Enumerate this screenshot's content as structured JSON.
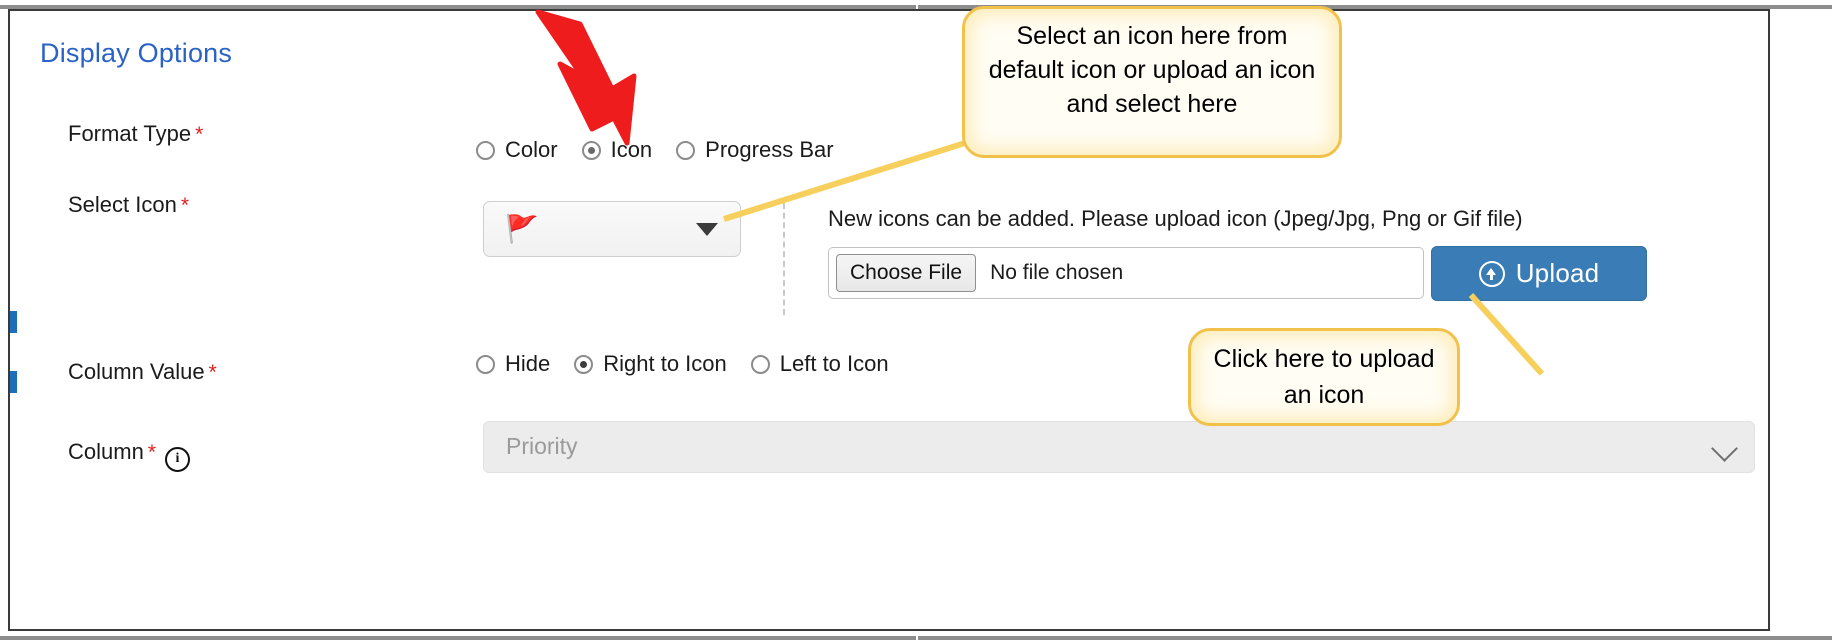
{
  "section": {
    "title": "Display Options"
  },
  "fields": {
    "format_type": {
      "label": "Format Type",
      "required_mark": "*",
      "options": [
        {
          "label": "Color",
          "selected": false
        },
        {
          "label": "Icon",
          "selected": true
        },
        {
          "label": "Progress Bar",
          "selected": false
        }
      ]
    },
    "select_icon": {
      "label": "Select Icon",
      "required_mark": "*",
      "selected_icon": "🚩",
      "icon_name": "red-flag-icon",
      "caret_icon": "caret-down-icon"
    },
    "column_value": {
      "label": "Column Value",
      "required_mark": "*",
      "options": [
        {
          "label": "Hide",
          "selected": false
        },
        {
          "label": "Right to Icon",
          "selected": true
        },
        {
          "label": "Left to Icon",
          "selected": false
        }
      ]
    },
    "column": {
      "label": "Column",
      "required_mark": "*",
      "info_icon": "i",
      "placeholder": "Priority",
      "chevron_icon": "chevron-down-icon"
    }
  },
  "upload": {
    "help_text": "New icons can be added. Please upload icon (Jpeg/Jpg, Png or Gif file)",
    "choose_file_label": "Choose File",
    "file_status": "No file chosen",
    "upload_button_label": "Upload",
    "upload_icon": "arrow-up-circle-icon"
  },
  "annotations": {
    "callout_select": "Select an icon here from default icon or upload an icon and select here",
    "callout_upload": "Click here to upload an icon",
    "arrow_icon": "red-down-arrow-icon"
  },
  "colors": {
    "heading": "#2a62c6",
    "required": "#e02020",
    "upload_button": "#3a7cb5",
    "callout_border": "#f2c14a",
    "arrow": "#ee1c1c"
  }
}
